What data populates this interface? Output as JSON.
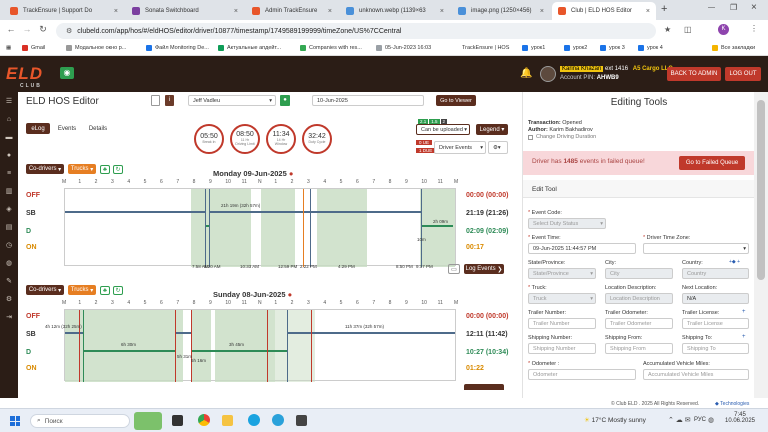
{
  "browser": {
    "tabs": [
      {
        "title": "TrackEnsure | Support Do",
        "color": "#e8562a"
      },
      {
        "title": "Sonata Switchboard",
        "color": "#7b3fa0"
      },
      {
        "title": "Admin TrackEnsure",
        "color": "#e8562a"
      },
      {
        "title": "unknown.webp (1139×63",
        "color": "#4a90d9"
      },
      {
        "title": "image.png (1250×456)",
        "color": "#4a90d9"
      },
      {
        "title": "Club | ELD HOS Editor",
        "color": "#e8562a"
      }
    ],
    "url": "clubeld.com/app/hos/#/eldHOS/editor/driver/10877/timestamp/1749589199999/timeZone/US%7CCentral",
    "bookmarks": [
      "Gmail",
      "Модальное окно р...",
      "Файл Monitoring De...",
      "Актуальные апдейт...",
      "Companies with res...",
      "05-Jun-2023 16:03",
      "TrackEnsure | HOS",
      "урок1",
      "урок2",
      "урок 3",
      "урок 4",
      "Все закладки"
    ]
  },
  "header": {
    "logo_main": "ELD",
    "logo_sub": "CLUB",
    "user_name": "Karina Khazan",
    "ext": "ext 1416",
    "company": "A5 Cargo LLC",
    "account_label": "Account PIN:",
    "account_pin": "AHWB9",
    "back_label": "BACK TO ADMIN",
    "logout_label": "LOG OUT"
  },
  "editor": {
    "title": "ELD HOS Editor",
    "driver": "Jeff Vadleu",
    "date": "10-Jun-2025",
    "go_viewer": "Go to Viewer",
    "tabs": [
      "eLog",
      "Events",
      "Details"
    ],
    "clocks": [
      {
        "time": "05:50",
        "label": "Break In",
        "sub": ""
      },
      {
        "time": "08:50",
        "label": "Driving Limit",
        "sub": "11 Hr"
      },
      {
        "time": "11:34",
        "label": "Window",
        "sub": "14 Hr"
      },
      {
        "time": "32:42",
        "label": "Duty Cycle",
        "sub": ""
      }
    ],
    "can_upload": "Can be uploaded",
    "legend": "Legend",
    "badges": [
      "2.1",
      "1.5",
      "2"
    ],
    "ue": "0 UE",
    "due": "1 DUE",
    "driver_events": "Driver Events",
    "codrivers": "Co-drivers",
    "trucks": "Trucks",
    "hours": [
      "M",
      "1",
      "2",
      "3",
      "4",
      "5",
      "6",
      "7",
      "8",
      "9",
      "10",
      "11",
      "N",
      "1",
      "2",
      "3",
      "4",
      "5",
      "6",
      "7",
      "8",
      "9",
      "10",
      "11",
      "M"
    ],
    "statuses": [
      "OFF",
      "SB",
      "D",
      "ON"
    ],
    "log_events": "Log Events"
  },
  "day1": {
    "title": "Monday 09-Jun-2025",
    "totals": [
      "00:00 (00:00)",
      "21:19 (21:26)",
      "02:09 (02:09)",
      "00:17"
    ],
    "annotations": [
      "21h 19m (32h 57m)",
      "2h 09m",
      "10m"
    ],
    "times": [
      "7:58 AM",
      "8:20 AM",
      "10:33 AM",
      "12:59 PM",
      "2:22 PM",
      "4:29 PM",
      "8:50 PM",
      "9:17 PM"
    ]
  },
  "day2": {
    "title": "Sunday 08-Jun-2025",
    "totals": [
      "00:00 (00:00)",
      "12:11 (11:42)",
      "10:27 (10:34)",
      "01:22"
    ],
    "annotations": [
      "4h 12m (32h 25m)",
      "6h 30m",
      "3h 45m",
      "11h 37m (32h 57m)",
      "5h 16m",
      "5h 31m"
    ]
  },
  "tools": {
    "title": "Editing Tools",
    "transaction_label": "Transaction:",
    "transaction": "Opened",
    "author_label": "Author:",
    "author": "Karim Bakhadirov",
    "change_duration": "Change Driving Duration",
    "failed_text_a": "Driver has",
    "failed_count": "1485",
    "failed_text_b": "events in failed queue!",
    "failed_btn": "Go to Failed Queue",
    "edit_tool": "Edit Tool",
    "event_code_label": "Event Code:",
    "event_code_ph": "Select Duty Status",
    "event_time_label": "Event Time:",
    "event_time": "09-Jun-2025 11:44:57 PM",
    "tz_label": "Driver Time Zone:",
    "state_label": "State/Province:",
    "state_ph": "State/Province",
    "city_label": "City:",
    "city_ph": "City",
    "country_label": "Country:",
    "country_ph": "Country",
    "truck_label": "Truck:",
    "truck_ph": "Truck",
    "locdesc_label": "Location Description:",
    "locdesc_ph": "Location Description",
    "nextloc_label": "Next Location:",
    "nextloc": "N/A",
    "trailer_label": "Trailer Number:",
    "trailer_ph": "Trailer Number",
    "trailer_odo_label": "Trailer Odometer:",
    "trailer_odo_ph": "Trailer Odometer",
    "trailer_lic_label": "Trailer License:",
    "trailer_lic_ph": "Trailer License",
    "ship_num_label": "Shipping Number:",
    "ship_num_ph": "Shipping Number",
    "ship_from_label": "Shipping From:",
    "ship_from_ph": "Shipping From",
    "ship_to_label": "Shipping To:",
    "ship_to_ph": "Shipping To",
    "odometer_label": "Odometer :",
    "odometer_ph": "Odometer",
    "acc_miles_label": "Accumulated Vehicle Miles:",
    "acc_miles_ph": "Accumulated Vehicle Miles"
  },
  "footer": {
    "copy": "© Club ELD . 2025 All Rights Reserved.",
    "powered": "Technologies"
  },
  "taskbar": {
    "search": "Поиск",
    "weather": "17°C  Mostly sunny",
    "lang": "РУС",
    "time": "7:45",
    "date": "10.06.2025"
  },
  "colors": {
    "brand": "#e8562a",
    "header": "#2b1d16",
    "danger": "#c0392b",
    "driving": "#2e8b57",
    "on_duty": "#d98a00"
  }
}
